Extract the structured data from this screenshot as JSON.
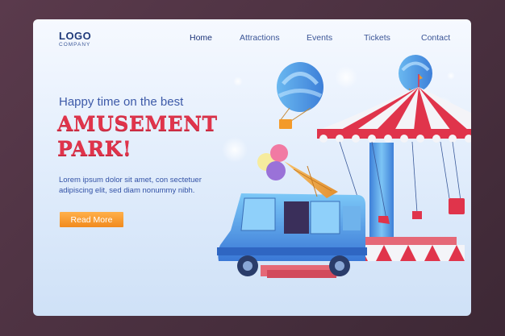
{
  "logo": {
    "main": "LOGO",
    "sub": "COMPANY"
  },
  "nav": {
    "home": "Home",
    "attractions": "Attractions",
    "events": "Events",
    "tickets": "Tickets",
    "contact": "Contact"
  },
  "hero": {
    "tagline": "Happy time on the best",
    "headline_line1": "AMUSEMENT",
    "headline_line2": "PARK!",
    "description": "Lorem ipsum dolor sit amet, con sectetuer adipiscing elit, sed diam nonummy nibh.",
    "cta": "Read More"
  },
  "colors": {
    "accent": "#e0344b",
    "nav_text": "#3b5596",
    "button": "#f5951f",
    "background": "#e3eefc"
  },
  "illustration": {
    "icons": [
      "hot-air-balloon-icon",
      "carousel-icon",
      "ice-cream-truck-icon"
    ]
  }
}
